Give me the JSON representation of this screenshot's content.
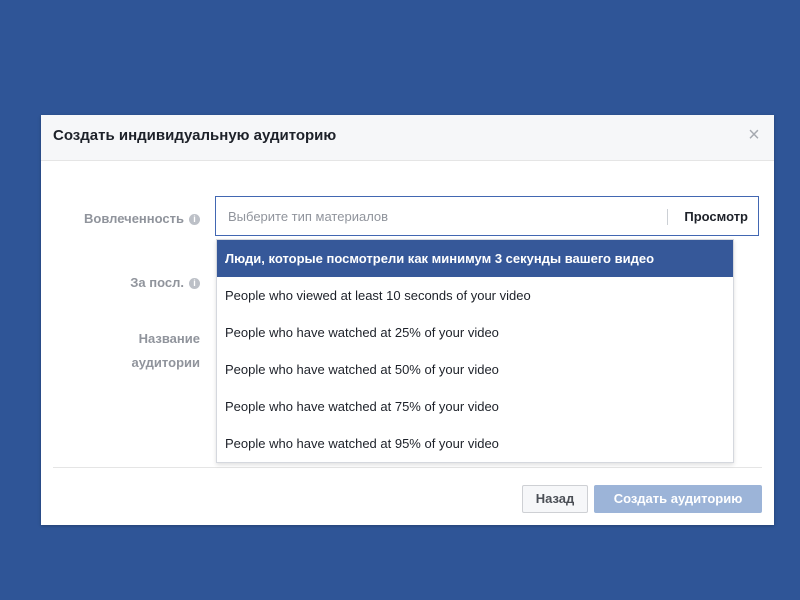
{
  "dialog": {
    "title": "Создать индивидуальную аудиторию",
    "close_icon": "×"
  },
  "form": {
    "engagement_label": "Вовлеченность",
    "period_label": "За посл.",
    "name_label": "Название аудитории",
    "info_icon_glyph": "i"
  },
  "select": {
    "placeholder": "Выберите тип материалов",
    "preview_label": "Просмотр"
  },
  "dropdown": {
    "options": [
      "Люди, которые посмотрели как минимум 3 секунды вашего видео",
      "People who viewed at least 10 seconds of your video",
      "People who have watched at 25% of your video",
      "People who have watched at 50% of your video",
      "People who have watched at 75% of your video",
      "People who have watched at 95% of your video"
    ],
    "selected_index": 0
  },
  "footer": {
    "back_label": "Назад",
    "create_label": "Создать аудиторию"
  },
  "colors": {
    "background": "#2f5597",
    "selected_option": "#365899",
    "create_button_disabled": "#9cb4d8"
  }
}
